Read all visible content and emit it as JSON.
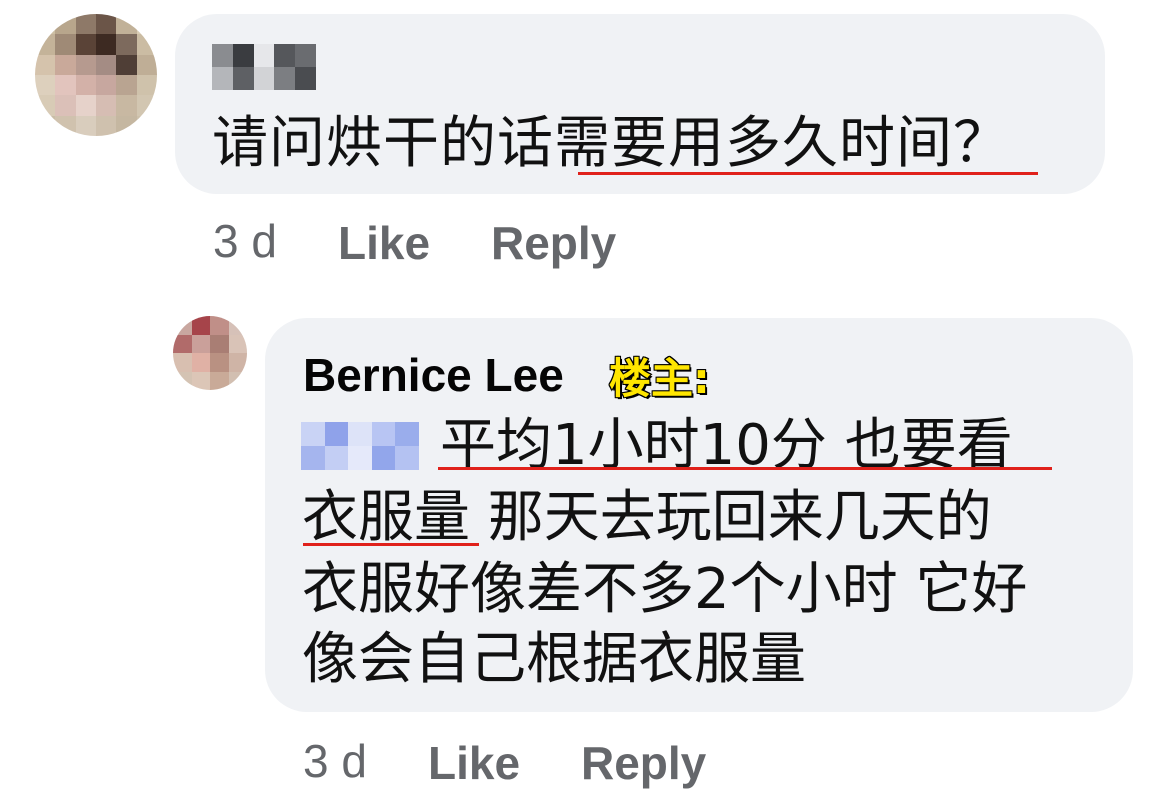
{
  "comment1": {
    "text": "请问烘干的话需要用多久时间？",
    "time": "3 d",
    "like_label": "Like",
    "reply_label": "Reply"
  },
  "comment2": {
    "author": "Bernice Lee",
    "op_tag": "楼主:",
    "lines": [
      "平均1小时10分 也要看",
      "衣服量 那天去玩回来几天的",
      "衣服好像差不多2个小时 它好",
      "像会自己根据衣服量"
    ],
    "time": "3 d",
    "like_label": "Like",
    "reply_label": "Reply"
  },
  "colors": {
    "bubble": "#f0f2f5",
    "meta_text": "#65676b",
    "underline": "#e0211b",
    "op_tag": "#ffe600"
  }
}
